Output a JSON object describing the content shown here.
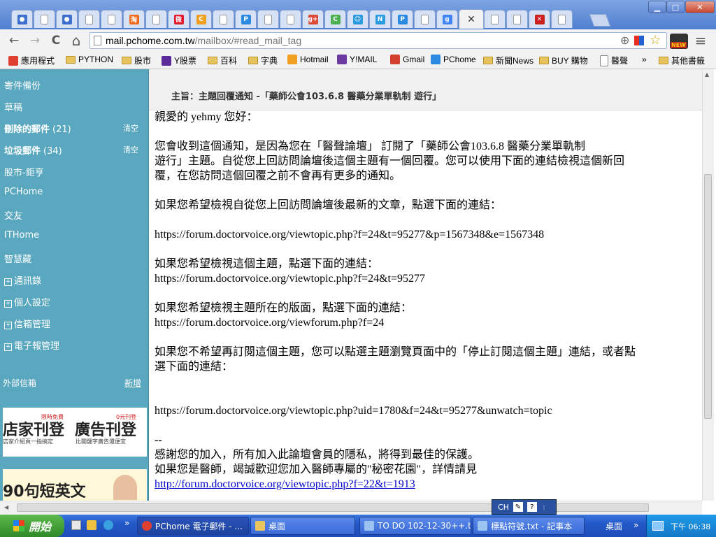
{
  "window": {
    "minimize": "▁",
    "maximize": "□",
    "close": "✕"
  },
  "tabs": [
    {
      "icon": "bubble-icon",
      "color": "#3c6fd0",
      "glyph": "●"
    },
    {
      "icon": "page-icon",
      "color": "#ffffff",
      "glyph": ""
    },
    {
      "icon": "bubble-icon",
      "color": "#3c6fd0",
      "glyph": "●"
    },
    {
      "icon": "page-icon",
      "color": "#ffffff",
      "glyph": ""
    },
    {
      "icon": "page-icon",
      "color": "#ffffff",
      "glyph": ""
    },
    {
      "icon": "taobao-icon",
      "color": "#f26b1d",
      "glyph": "淘"
    },
    {
      "icon": "page-icon",
      "color": "#ffffff",
      "glyph": ""
    },
    {
      "icon": "weibo-icon",
      "color": "#e6162d",
      "glyph": "微"
    },
    {
      "icon": "colorful-icon",
      "color": "#f0a020",
      "glyph": "C"
    },
    {
      "icon": "page-icon",
      "color": "#ffffff",
      "glyph": ""
    },
    {
      "icon": "pchome-icon",
      "color": "#2c8be0",
      "glyph": "P"
    },
    {
      "icon": "page-icon",
      "color": "#ffffff",
      "glyph": ""
    },
    {
      "icon": "page-icon",
      "color": "#ffffff",
      "glyph": ""
    },
    {
      "icon": "google-plus-icon",
      "color": "#dd4b39",
      "glyph": "g+"
    },
    {
      "icon": "chrome-c-icon",
      "color": "#4caf50",
      "glyph": "C"
    },
    {
      "icon": "smiley-icon",
      "color": "#2c9be0",
      "glyph": "☺"
    },
    {
      "icon": "nn-icon",
      "color": "#2c9be0",
      "glyph": "N"
    },
    {
      "icon": "pchome-icon",
      "color": "#2c8be0",
      "glyph": "P"
    },
    {
      "icon": "page-icon",
      "color": "#ffffff",
      "glyph": ""
    },
    {
      "icon": "google-icon",
      "color": "#4285f4",
      "glyph": "g"
    },
    {
      "icon": "active-tab",
      "color": "#f2f2f2",
      "glyph": "✕"
    },
    {
      "icon": "page-icon",
      "color": "#ffffff",
      "glyph": ""
    },
    {
      "icon": "page-icon",
      "color": "#ffffff",
      "glyph": ""
    },
    {
      "icon": "cross-red-icon",
      "color": "#cc2020",
      "glyph": "✕"
    },
    {
      "icon": "page-icon",
      "color": "#ffffff",
      "glyph": ""
    }
  ],
  "address": {
    "host": "mail.pchome.com.tw",
    "path": "/mailbox/#read_mail_tag"
  },
  "toolbar": {
    "back": "←",
    "forward": "→",
    "reload": "C",
    "home": "⌂",
    "zoom": "⊕",
    "star": "☆",
    "menu": "≡",
    "new_badge": "NEW"
  },
  "bookmarks": [
    {
      "label": "應用程式",
      "icon": "apps-grid-icon",
      "type": "icon",
      "color": "#e04030"
    },
    {
      "label": "PYTHON",
      "icon": "folder-icon",
      "type": "folder"
    },
    {
      "label": "股市",
      "icon": "folder-icon",
      "type": "folder"
    },
    {
      "label": "Y股票",
      "icon": "yahoo-icon",
      "type": "icon",
      "color": "#5a2a9a"
    },
    {
      "label": "百科",
      "icon": "folder-icon",
      "type": "folder"
    },
    {
      "label": "字典",
      "icon": "folder-icon",
      "type": "folder"
    },
    {
      "label": "Hotmail",
      "icon": "windows-icon",
      "type": "icon",
      "color": "#f0a020"
    },
    {
      "label": "Y!MAIL",
      "icon": "mail-icon",
      "type": "icon",
      "color": "#6a3aa0"
    },
    {
      "label": "Gmail",
      "icon": "gmail-icon",
      "type": "icon",
      "color": "#d44030"
    },
    {
      "label": "PChome",
      "icon": "pchome-icon",
      "type": "icon",
      "color": "#2c8be0"
    },
    {
      "label": "新聞News",
      "icon": "folder-icon",
      "type": "folder"
    },
    {
      "label": "BUY 購物",
      "icon": "folder-icon",
      "type": "folder"
    },
    {
      "label": "醫聲",
      "icon": "page-icon",
      "type": "page"
    }
  ],
  "bookmarks_more": "»",
  "bookmarks_other": "其他書籤",
  "sidebar": {
    "items": [
      {
        "label": "寄件備份",
        "bold": false
      },
      {
        "label": "草稿",
        "bold": false
      },
      {
        "label": "刪除的郵件",
        "bold": true,
        "count": "(21)",
        "action": "清空"
      },
      {
        "label": "垃圾郵件",
        "bold": true,
        "count": "(34)",
        "action": "清空"
      },
      {
        "label": "股市-鉅亨",
        "bold": false
      },
      {
        "label": "PCHome",
        "bold": false
      },
      {
        "label": "交友",
        "bold": false
      },
      {
        "label": "ITHome",
        "bold": false
      },
      {
        "label": "智慧藏",
        "bold": false
      }
    ],
    "tree": [
      "通訊錄",
      "個人設定",
      "信箱管理",
      "電子報管理"
    ],
    "external": {
      "label": "外部信箱",
      "action": "新增"
    },
    "ad1": {
      "left_big": "店家刊登",
      "left_tag": "限時免費",
      "left_small": "店家介紹頁一指搞定",
      "right_big": "廣告刊登",
      "right_tag": "0元刊登",
      "right_small": "比關鍵字廣告還便宜"
    },
    "ad2": {
      "text": "90句短英文"
    }
  },
  "message": {
    "subject": "主旨：主題回覆通知 -「藥師公會103.6.8 醫藥分業單軌制 遊行」",
    "greeting": "親愛的 yehmy 您好：",
    "p1": "您會收到這個通知，是因為您在「醫聲論壇」 訂閱了「藥師公會103.6.8 醫藥分業單軌制\n遊行」主題。自從您上回訪問論壇後這個主題有一個回覆。您可以使用下面的連結檢視這個新回\n覆，在您訪問這個回覆之前不會再有更多的通知。",
    "p2": "如果您希望檢視自從您上回訪問論壇後最新的文章，點選下面的連結：",
    "link1": "https://forum.doctorvoice.org/viewtopic.php?f=24&t=95277&p=1567348&e=1567348",
    "p3": "如果您希望檢視這個主題，點選下面的連結：",
    "link2": "https://forum.doctorvoice.org/viewtopic.php?f=24&t=95277",
    "p4": "如果您希望檢視主題所在的版面，點選下面的連結：",
    "link3": "https://forum.doctorvoice.org/viewforum.php?f=24",
    "p5": "如果您不希望再訂閱這個主題，您可以點選主題瀏覽頁面中的「停止訂閱這個主題」連結，或者點\n選下面的連結：",
    "link4": "https://forum.doctorvoice.org/viewtopic.php?uid=1780&f=24&t=95277&unwatch=topic",
    "sig_sep": "--",
    "sig1": "感謝您的加入，所有加入此論壇會員的隱私，將得到最佳的保護。",
    "sig2": "如果您是醫師，竭誠歡迎您加入醫師專屬的\"秘密花園\"，詳情請見",
    "sig_link": "http://forum.doctorvoice.org/viewtopic.php?f=22&t=1913"
  },
  "ime": {
    "label": "CH"
  },
  "taskbar": {
    "start": "開始",
    "quick_more": "»",
    "buttons": [
      {
        "label": "PChome 電子郵件 - ...",
        "icon": "chrome-icon",
        "color": "#e04030"
      },
      {
        "label": "桌面",
        "icon": "folder-icon",
        "color": "#e8c45c"
      },
      {
        "label": "TO DO 102-12-30++.t...",
        "icon": "notepad-icon",
        "color": "#9cc4f0"
      },
      {
        "label": "標點符號.txt - 記事本",
        "icon": "notepad-icon",
        "color": "#9cc4f0"
      }
    ],
    "desktop_label": "桌面",
    "tray_more": "»",
    "clock": "下午 06:38"
  }
}
